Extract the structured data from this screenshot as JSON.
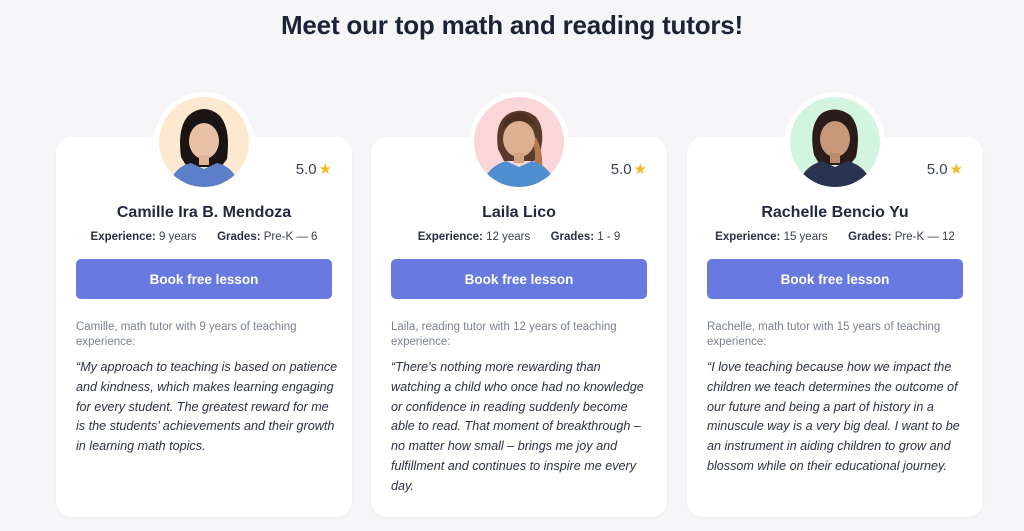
{
  "page": {
    "title": "Meet our top math and reading tutors!"
  },
  "colors": {
    "button": "#6879e0",
    "star": "#f5b921",
    "background": "#f6f6f8"
  },
  "labels": {
    "experience": "Experience:",
    "grades": "Grades:"
  },
  "tutors": [
    {
      "name": "Camille Ira B. Mendoza",
      "rating": "5.0",
      "experience": "9 years",
      "grades": "Pre-K — 6",
      "button": "Book free lesson",
      "intro": "Camille, math tutor with 9 years of teaching experience:",
      "quote": "“My approach to teaching is based on patience and kindness, which makes learning engaging for every student. The greatest reward for me is the students’ achievements and their growth in learning math topics.",
      "avatar_bg": "#fde9cf"
    },
    {
      "name": "Laila Lico",
      "rating": "5.0",
      "experience": "12 years",
      "grades": "1 - 9",
      "button": "Book free lesson",
      "intro": "Laila, reading tutor with 12 years of teaching experience:",
      "quote": "“There's nothing more rewarding than watching a child who once had no knowledge or confidence in reading suddenly become able to read. That moment of breakthrough – no matter how small – brings me joy and fulfillment and continues to inspire me every day.",
      "avatar_bg": "#fbd6d8"
    },
    {
      "name": "Rachelle Bencio Yu",
      "rating": "5.0",
      "experience": "15 years",
      "grades": "Pre-K — 12",
      "button": "Book free lesson",
      "intro": "Rachelle, math tutor with 15 years of teaching experience:",
      "quote": "“I love teaching because how we impact the children we teach determines the outcome of our future and being a part of history in a minuscule way is a very big deal. I want to be an instrument in aiding children to grow and blossom while on their educational journey.",
      "avatar_bg": "#d3f5df"
    }
  ]
}
